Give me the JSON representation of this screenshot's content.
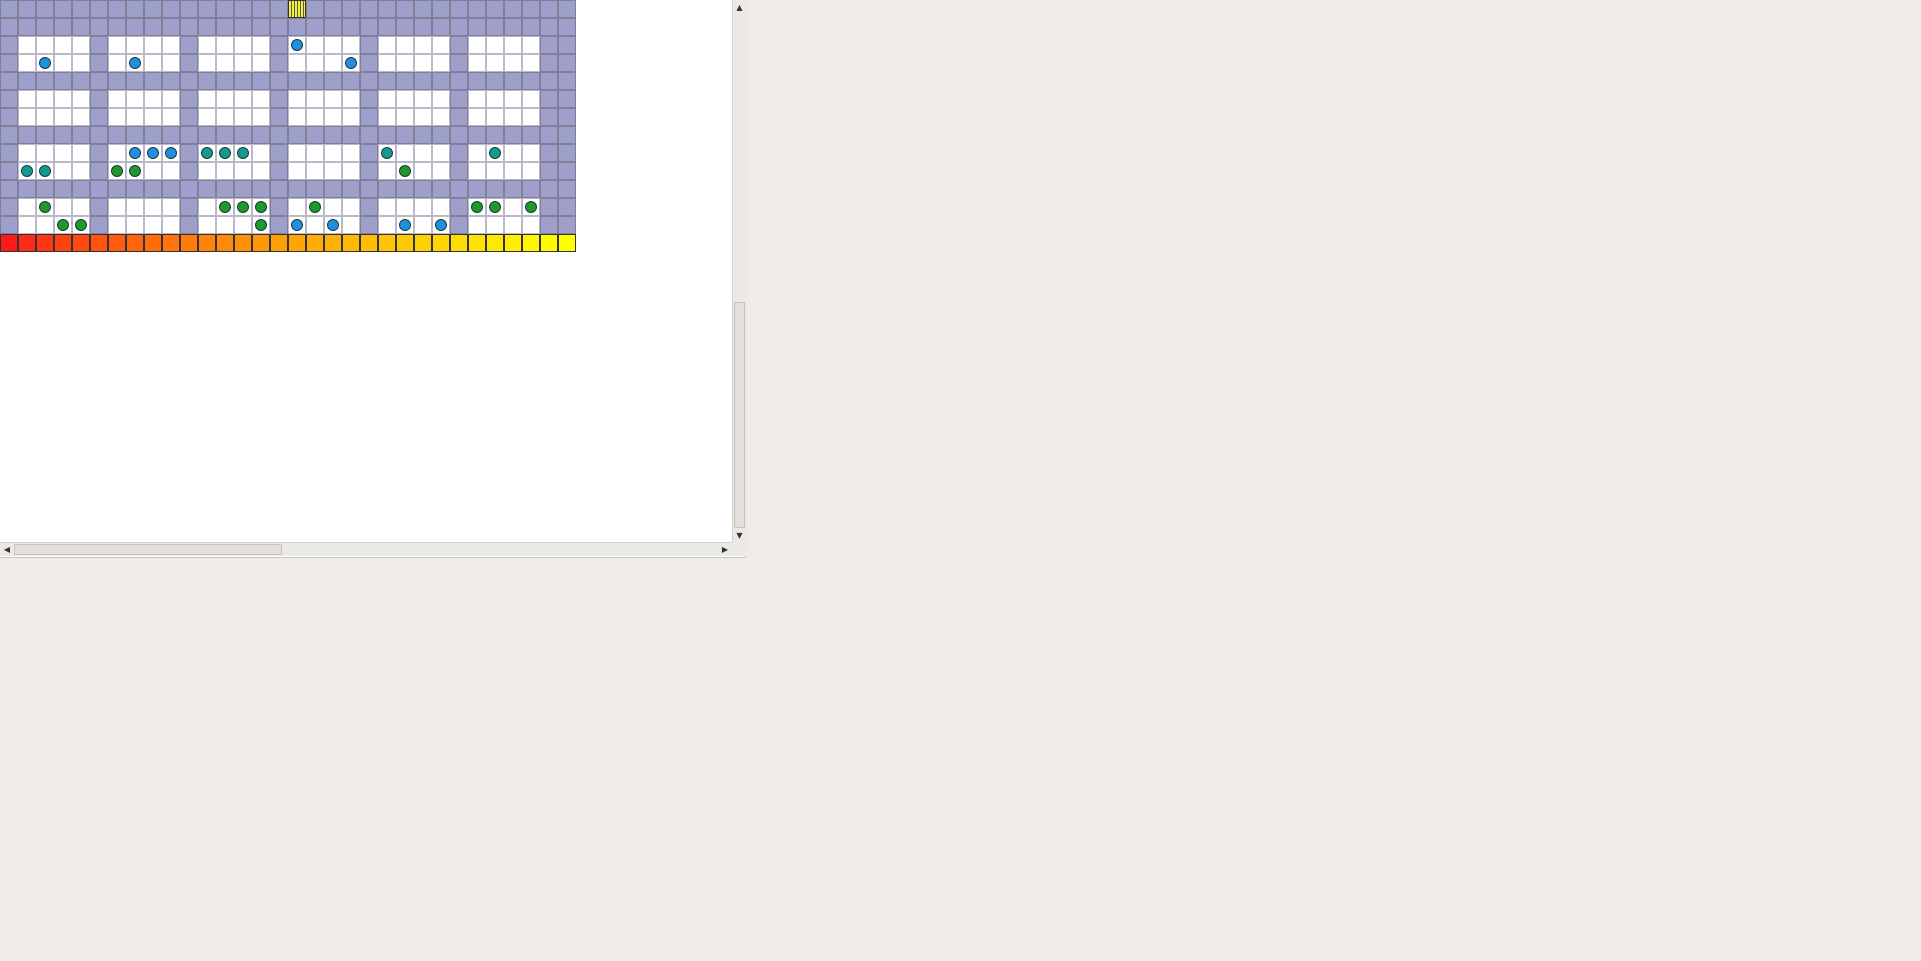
{
  "board": {
    "rows": 14,
    "cols": 32,
    "colors": {
      "wall": "#9f9fcb",
      "room": "#ffffff",
      "marble_blue": "#1e90e0",
      "marble_teal": "#139a90",
      "marble_green": "#1c9a2a",
      "player_highlight": "#f5ee4a"
    },
    "player_cell": [
      0,
      16
    ],
    "marbles": [
      {
        "row": 2,
        "col": 16,
        "color": "blue"
      },
      {
        "row": 3,
        "col": 2,
        "color": "blue"
      },
      {
        "row": 3,
        "col": 7,
        "color": "blue"
      },
      {
        "row": 3,
        "col": 19,
        "color": "blue"
      },
      {
        "row": 8,
        "col": 7,
        "color": "blue"
      },
      {
        "row": 8,
        "col": 8,
        "color": "blue"
      },
      {
        "row": 8,
        "col": 9,
        "color": "blue"
      },
      {
        "row": 8,
        "col": 11,
        "color": "teal"
      },
      {
        "row": 8,
        "col": 12,
        "color": "teal"
      },
      {
        "row": 8,
        "col": 13,
        "color": "teal"
      },
      {
        "row": 8,
        "col": 21,
        "color": "teal"
      },
      {
        "row": 8,
        "col": 27,
        "color": "teal"
      },
      {
        "row": 9,
        "col": 1,
        "color": "teal"
      },
      {
        "row": 9,
        "col": 2,
        "color": "teal"
      },
      {
        "row": 9,
        "col": 6,
        "color": "green"
      },
      {
        "row": 9,
        "col": 7,
        "color": "green"
      },
      {
        "row": 9,
        "col": 22,
        "color": "green"
      },
      {
        "row": 11,
        "col": 2,
        "color": "green"
      },
      {
        "row": 11,
        "col": 12,
        "color": "green"
      },
      {
        "row": 11,
        "col": 13,
        "color": "green"
      },
      {
        "row": 11,
        "col": 14,
        "color": "green"
      },
      {
        "row": 11,
        "col": 17,
        "color": "green"
      },
      {
        "row": 11,
        "col": 26,
        "color": "green"
      },
      {
        "row": 11,
        "col": 27,
        "color": "green"
      },
      {
        "row": 11,
        "col": 29,
        "color": "green"
      },
      {
        "row": 12,
        "col": 3,
        "color": "green"
      },
      {
        "row": 12,
        "col": 4,
        "color": "green"
      },
      {
        "row": 12,
        "col": 14,
        "color": "green"
      },
      {
        "row": 12,
        "col": 16,
        "color": "blue"
      },
      {
        "row": 12,
        "col": 18,
        "color": "blue"
      },
      {
        "row": 12,
        "col": 22,
        "color": "blue"
      },
      {
        "row": 12,
        "col": 24,
        "color": "blue"
      }
    ],
    "palette_row": [
      "#ff1a1a",
      "#ff2a18",
      "#ff3616",
      "#ff4114",
      "#ff4a12",
      "#ff5310",
      "#ff5c0f",
      "#ff640e",
      "#ff6c0c",
      "#ff740b",
      "#ff7c0a",
      "#ff830a",
      "#ff8a09",
      "#ff9108",
      "#ff9808",
      "#ff9f07",
      "#ffa606",
      "#ffac06",
      "#ffb206",
      "#ffb805",
      "#ffbe05",
      "#ffc404",
      "#ffca04",
      "#ffd004",
      "#ffd603",
      "#ffdc03",
      "#ffe202",
      "#ffe802",
      "#ffee01",
      "#fff401",
      "#fffa00",
      "#ffff00"
    ]
  },
  "scrollbars": {
    "vertical": {
      "position": 0.55
    },
    "horizontal": {
      "position": 0.0
    }
  },
  "icons": {
    "up": "▲",
    "down": "▼",
    "left": "◀",
    "right": "▶"
  }
}
